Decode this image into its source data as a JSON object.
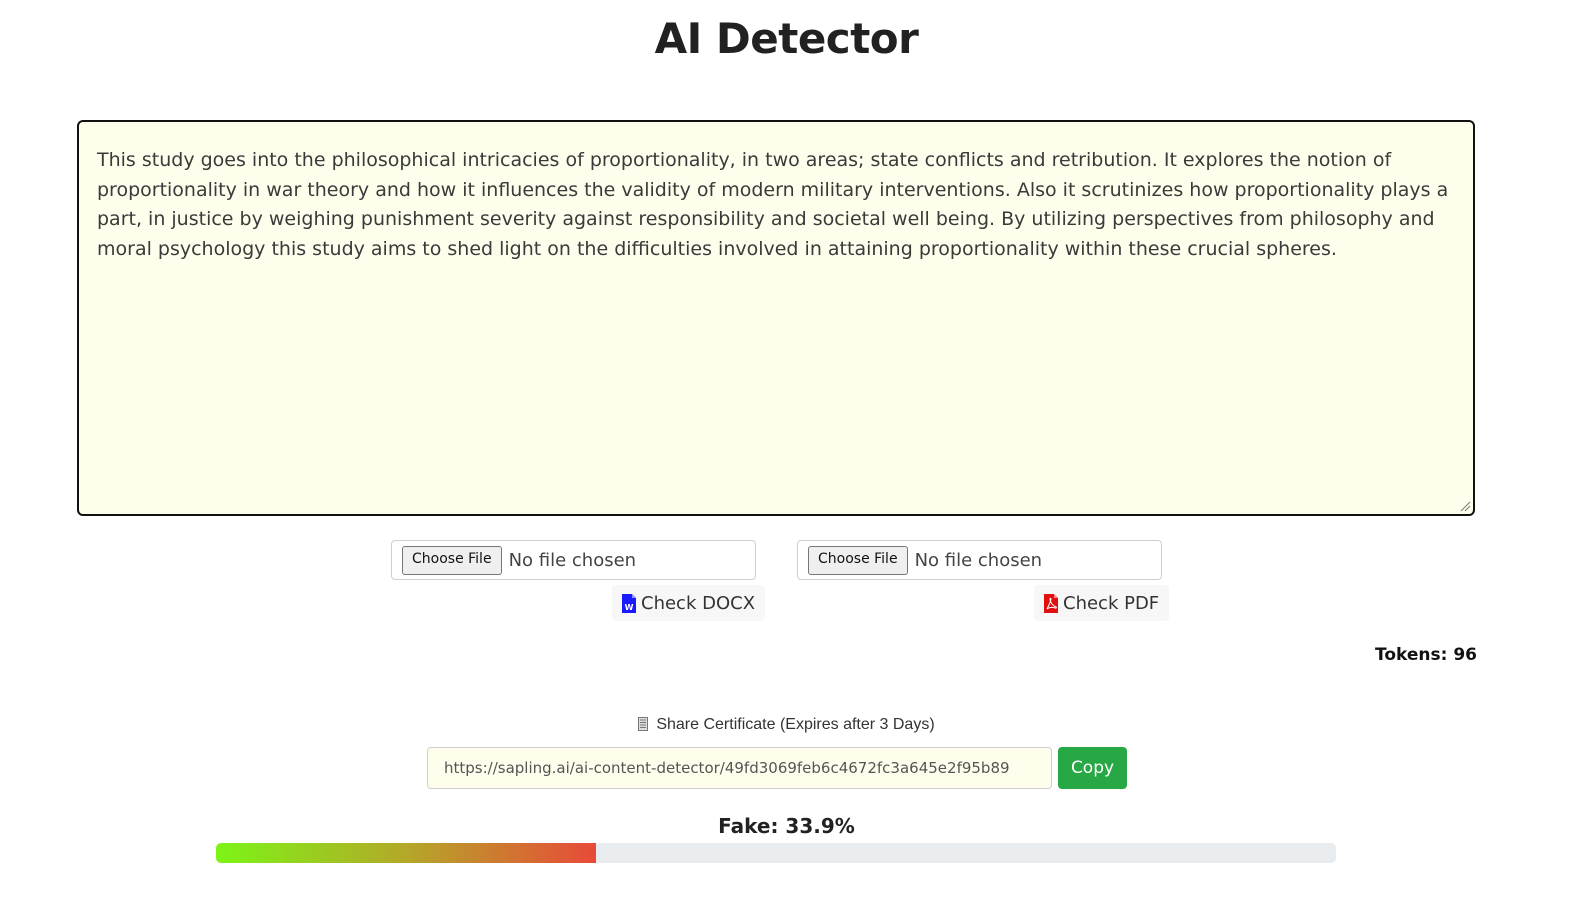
{
  "page": {
    "title": "AI Detector"
  },
  "editor": {
    "text": "This study goes into the philosophical intricacies of proportionality, in two areas; state conflicts and retribution. It explores the notion of proportionality in war theory and how it influences the validity of modern military interventions. Also it scrutinizes how proportionality plays a part, in justice by weighing punishment severity against responsibility and societal well being. By utilizing perspectives from philosophy and moral psychology this study aims to shed light on the difficulties involved in attaining proportionality within these crucial spheres.",
    "background_color": "#fffeec"
  },
  "uploads": {
    "docx": {
      "choose_label": "Choose File",
      "status": "No file chosen",
      "check_label": "Check DOCX",
      "icon": "word-icon",
      "icon_color": "#1a1aff"
    },
    "pdf": {
      "choose_label": "Choose File",
      "status": "No file chosen",
      "check_label": "Check PDF",
      "icon": "pdf-icon",
      "icon_color": "#e01010"
    }
  },
  "stats": {
    "tokens_label": "Tokens: 96"
  },
  "share": {
    "label": "Share Certificate (Expires after 3 Days)",
    "icon": "document-icon",
    "url": "https://sapling.ai/ai-content-detector/49fd3069feb6c4672fc3a645e2f95b89",
    "copy_label": "Copy",
    "copy_color": "#28a745"
  },
  "result": {
    "fake_label": "Fake: 33.9%",
    "fake_fraction": 0.339,
    "gradient_colors": [
      "#7cf516",
      "#b4a829",
      "#e84a38"
    ]
  }
}
